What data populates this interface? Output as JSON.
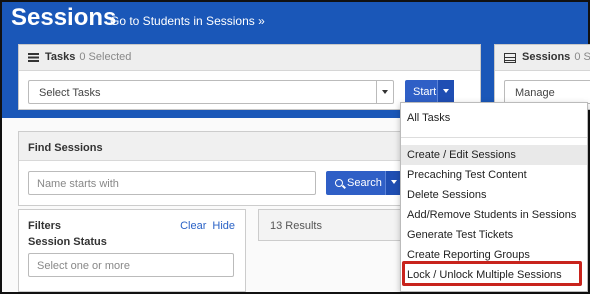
{
  "header": {
    "title": "Sessions",
    "link": "Go to Students in Sessions »"
  },
  "tasks_panel": {
    "title": "Tasks",
    "count": "0 Selected",
    "select_value": "Select Tasks",
    "start_label": "Start"
  },
  "sessions_panel": {
    "title": "Sessions",
    "count_fragment": "0 S",
    "select_value": "Manage"
  },
  "find_panel": {
    "title": "Find Sessions",
    "input_placeholder": "Name starts with",
    "search_label": "Search"
  },
  "filters": {
    "title": "Filters",
    "session_status": "Session Status",
    "clear_label": "Clear",
    "hide_label": "Hide",
    "status_placeholder": "Select one or more"
  },
  "results": {
    "text": "13 Results"
  },
  "menu": {
    "items": [
      "All Tasks",
      "Create / Edit Sessions",
      "Precaching Test Content",
      "Delete Sessions",
      "Add/Remove Students in Sessions",
      "Generate Test Tickets",
      "Create Reporting Groups",
      "Lock / Unlock Multiple Sessions"
    ]
  },
  "colors": {
    "header_blue": "#1a57b8",
    "primary_button": "#2f5fc6",
    "highlight_red": "#c8231c"
  }
}
